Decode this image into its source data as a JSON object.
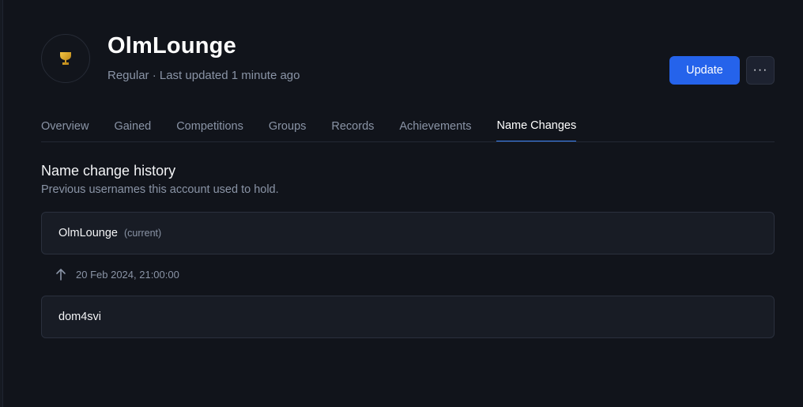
{
  "player": {
    "name": "OlmLounge",
    "subtitle": "Regular · Last updated 1 minute ago",
    "avatar_icon": "trophy-icon"
  },
  "actions": {
    "update_label": "Update",
    "more_label": "···"
  },
  "tabs": [
    {
      "label": "Overview",
      "active": false
    },
    {
      "label": "Gained",
      "active": false
    },
    {
      "label": "Competitions",
      "active": false
    },
    {
      "label": "Groups",
      "active": false
    },
    {
      "label": "Records",
      "active": false
    },
    {
      "label": "Achievements",
      "active": false
    },
    {
      "label": "Name Changes",
      "active": true
    }
  ],
  "section": {
    "title": "Name change history",
    "description": "Previous usernames this account used to hold."
  },
  "history": {
    "current": {
      "name": "OlmLounge",
      "tag": "(current)"
    },
    "change": {
      "icon": "arrow-up-icon",
      "date": "20 Feb 2024, 21:00:00"
    },
    "previous": {
      "name": "dom4svi"
    }
  },
  "colors": {
    "accent": "#2563eb",
    "background": "#11141b",
    "card": "#181c25",
    "trophy": "#d4a017"
  }
}
